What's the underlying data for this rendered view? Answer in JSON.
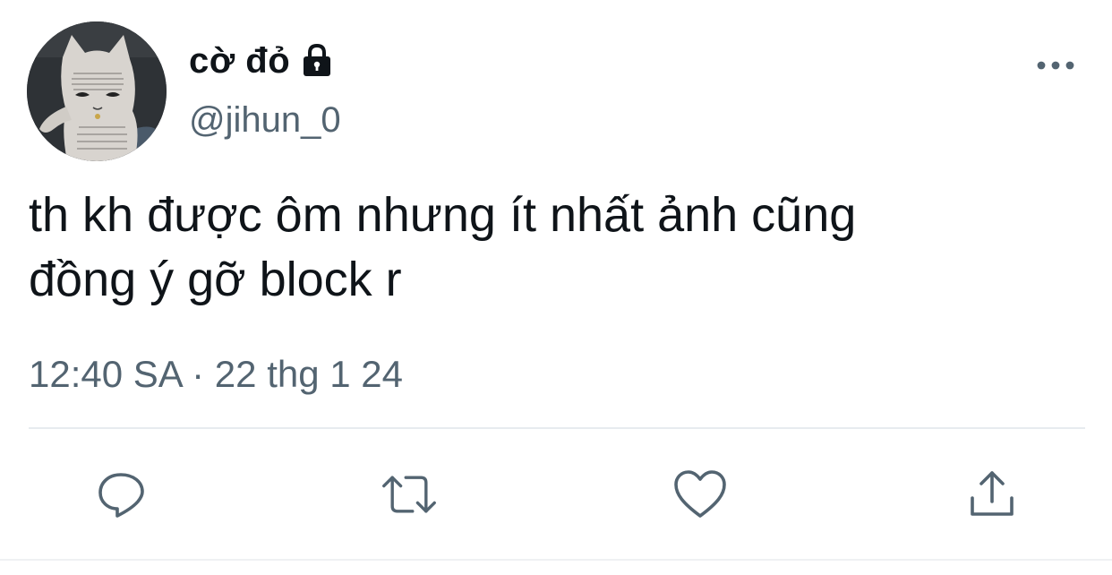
{
  "user": {
    "display_name": "cờ đỏ",
    "handle": "@jihun_0",
    "protected_icon": "lock-icon",
    "avatar_icon": "cat-avatar"
  },
  "tweet": {
    "text": "th kh được ôm nhưng ít nhất ảnh cũng\nđồng ý gỡ block r",
    "timestamp": "12:40 SA · 22 thg 1 24"
  },
  "menu": {
    "more_icon": "more-horizontal-icon"
  },
  "actions": [
    {
      "name": "reply",
      "icon": "reply-icon"
    },
    {
      "name": "retweet",
      "icon": "retweet-icon"
    },
    {
      "name": "like",
      "icon": "heart-icon"
    },
    {
      "name": "share",
      "icon": "share-icon"
    }
  ],
  "colors": {
    "text_primary": "#0f1419",
    "text_secondary": "#536471",
    "divider": "#e7ebef"
  }
}
